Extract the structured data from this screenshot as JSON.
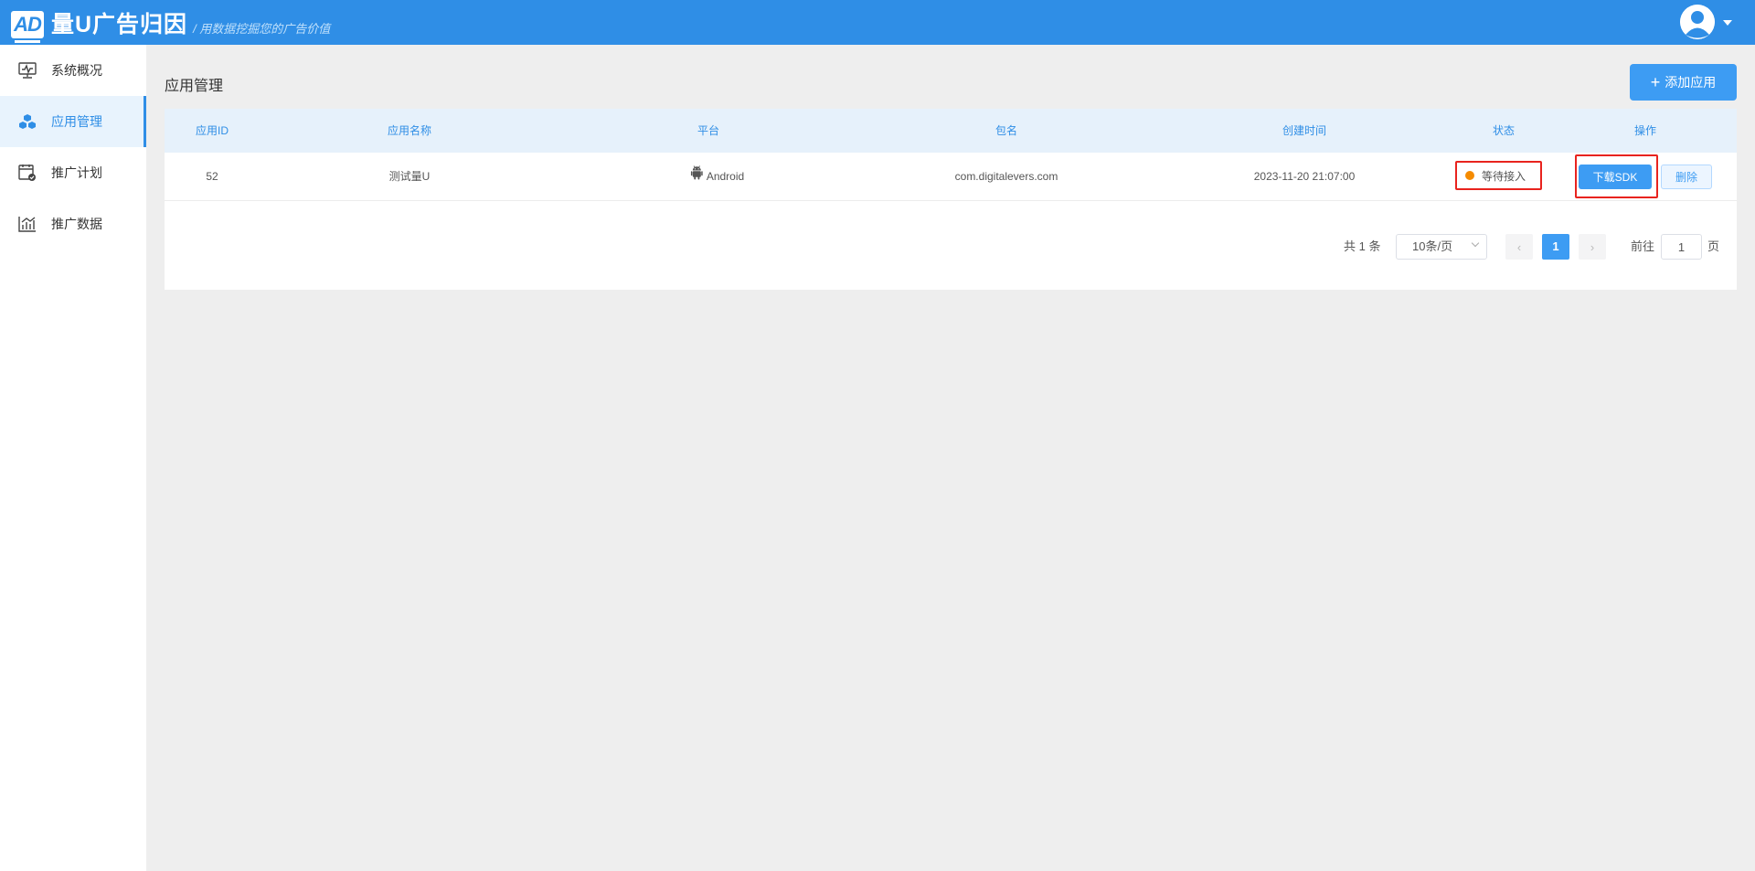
{
  "header": {
    "logo_badge": "AD",
    "logo_name": "量U广告归因",
    "slogan": "/ 用数据挖掘您的广告价值",
    "brand_color": "#2f8ee6"
  },
  "sidebar": {
    "items": [
      {
        "label": "系统概况",
        "icon": "monitor-icon",
        "active": false
      },
      {
        "label": "应用管理",
        "icon": "cubes-icon",
        "active": true
      },
      {
        "label": "推广计划",
        "icon": "calendar-check-icon",
        "active": false
      },
      {
        "label": "推广数据",
        "icon": "bar-chart-icon",
        "active": false
      }
    ]
  },
  "main": {
    "title": "应用管理",
    "add_button": {
      "icon": "+",
      "label": "添加应用"
    },
    "table": {
      "columns": [
        "应用ID",
        "应用名称",
        "平台",
        "包名",
        "创建时间",
        "状态",
        "操作"
      ],
      "rows": [
        {
          "id": "52",
          "name": "测试量U",
          "platform": "Android",
          "platform_icon": "android-icon",
          "package": "com.digitalevers.com",
          "created": "2023-11-20 21:07:00",
          "status": "等待接入",
          "status_color": "#f58b00",
          "actions": {
            "download": "下载SDK",
            "delete": "删除"
          }
        }
      ]
    },
    "pagination": {
      "total": "共 1 条",
      "page_size": "10条/页",
      "prev": "‹",
      "current": "1",
      "next": "›",
      "goto_label": "前往",
      "goto_value": "1",
      "page_suffix": "页"
    }
  }
}
